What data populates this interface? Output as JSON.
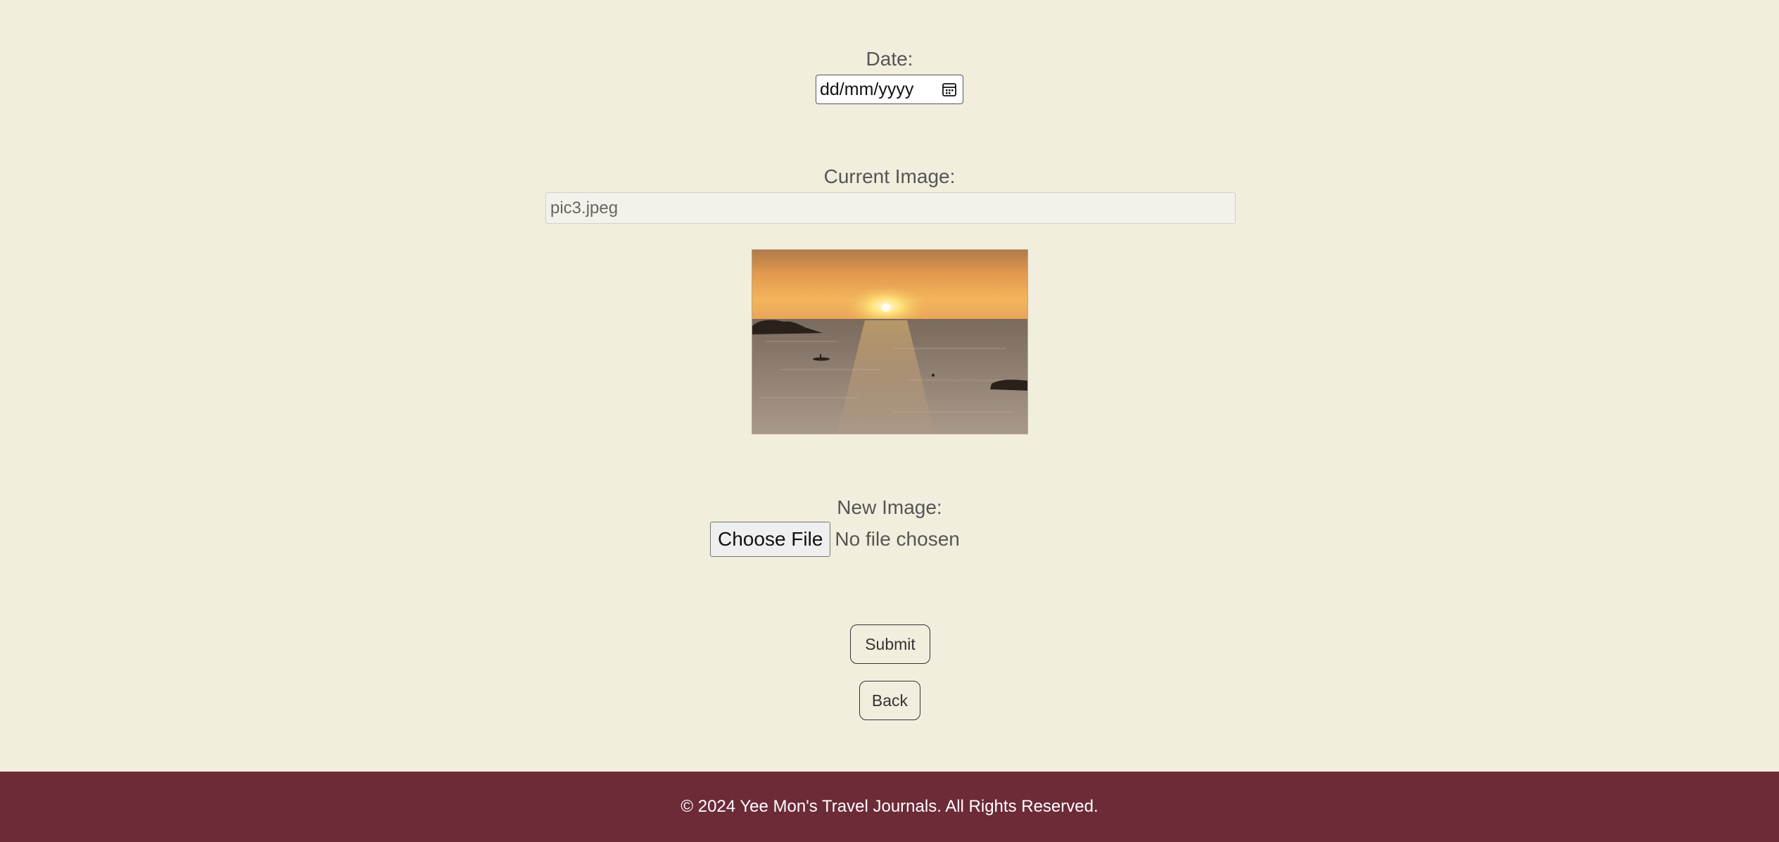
{
  "form": {
    "date_label": "Date:",
    "date_placeholder": "dd/mm/yyyy",
    "current_image_label": "Current Image:",
    "current_image_value": "pic3.jpeg",
    "new_image_label": "New Image:",
    "choose_file_label": "Choose File",
    "no_file_text": "No file chosen",
    "submit_label": "Submit",
    "back_label": "Back"
  },
  "icons": {
    "date_picker": "calendar-icon"
  },
  "footer": {
    "text": "© 2024 Yee Mon's Travel Journals. All Rights Reserved."
  },
  "colors": {
    "page_background": "#f2eedd",
    "footer_background": "#6d2a37",
    "footer_text": "#ffffff",
    "label_text": "#555555"
  }
}
